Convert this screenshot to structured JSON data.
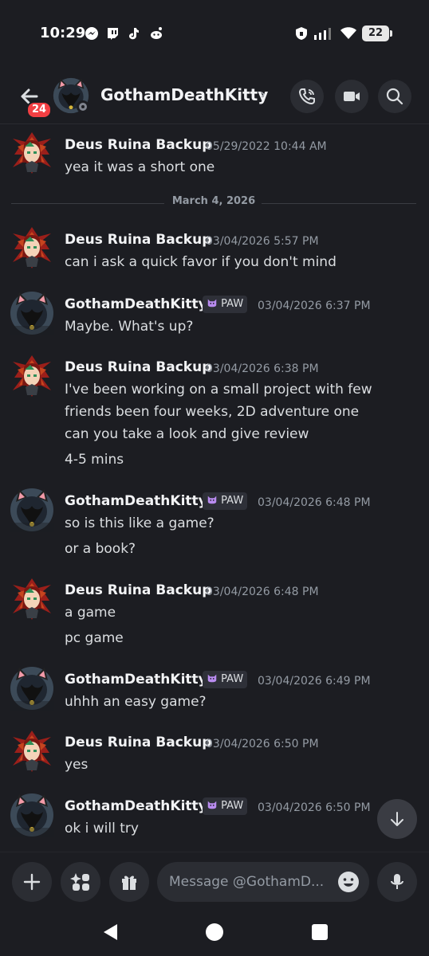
{
  "status_bar": {
    "time": "10:29",
    "battery": "22"
  },
  "header": {
    "unread_badge": "24",
    "title": "GothamDeathKitty",
    "chevron": "›",
    "icons": [
      "back-arrow-icon",
      "call-icon",
      "video-camera-icon",
      "search-icon"
    ]
  },
  "date_divider": "March 4, 2026",
  "messages": [
    {
      "author": "Deus Ruina Backup",
      "timestamp": "05/29/2022 10:44 AM",
      "lines": [
        "yea it was a short one"
      ]
    },
    {
      "author": "Deus Ruina Backup",
      "timestamp": "03/04/2026 5:57 PM",
      "lines": [
        "can i ask a quick favor if you don't mind"
      ]
    },
    {
      "author": "GothamDeathKitty",
      "tag": "PAW",
      "timestamp": "03/04/2026 6:37 PM",
      "lines": [
        "Maybe.  What's up?"
      ]
    },
    {
      "author": "Deus Ruina Backup",
      "timestamp": "03/04/2026 6:38 PM",
      "lines": [
        "I've been working on a small project with few",
        "friends been four weeks, 2D adventure one",
        "can you take a look and give review",
        "4-5 mins"
      ]
    },
    {
      "author": "GothamDeathKitty",
      "tag": "PAW",
      "timestamp": "03/04/2026 6:48 PM",
      "lines": [
        "so is this like a game?",
        "or a book?"
      ]
    },
    {
      "author": "Deus Ruina Backup",
      "timestamp": "03/04/2026 6:48 PM",
      "lines": [
        "a game",
        "pc game"
      ]
    },
    {
      "author": "GothamDeathKitty",
      "tag": "PAW",
      "timestamp": "03/04/2026 6:49 PM",
      "lines": [
        "uhhh an easy game?"
      ]
    },
    {
      "author": "Deus Ruina Backup",
      "timestamp": "03/04/2026 6:50 PM",
      "lines": [
        "yes"
      ]
    },
    {
      "author": "GothamDeathKitty",
      "tag": "PAW",
      "timestamp": "03/04/2026 6:50 PM",
      "lines": [
        "ok i will try"
      ]
    }
  ],
  "composer": {
    "placeholder": "Message @GothamD...",
    "icons": [
      "plus-icon",
      "apps-icon",
      "gift-icon",
      "emoji-icon",
      "microphone-icon"
    ]
  },
  "nav_bar": {
    "icons": [
      "back-triangle-icon",
      "home-circle-icon",
      "recents-square-icon"
    ]
  },
  "colors": {
    "background": "#1c1d22",
    "badge": "#f23f43",
    "muted": "#949ba4",
    "button": "#2b2d33"
  }
}
